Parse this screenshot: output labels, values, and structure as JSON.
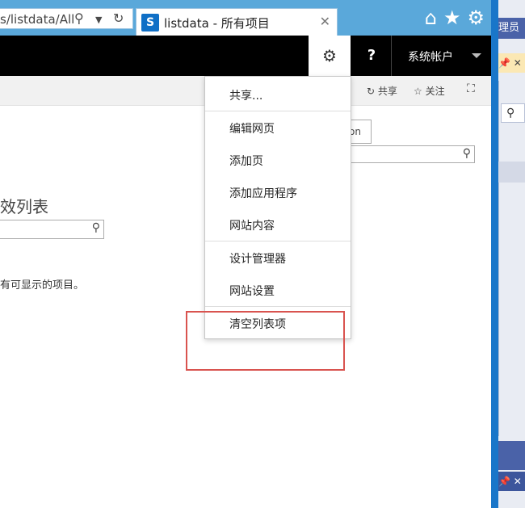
{
  "browser": {
    "address_url": "s/listdata/All",
    "tab_title": "listdata - 所有项目",
    "tab_close": "✕",
    "sp_logo": "S",
    "icons": [
      "home-icon",
      "favorites-star-icon",
      "tools-gear-icon"
    ]
  },
  "suitebar": {
    "help": "?",
    "account": "系统帐户"
  },
  "ribbon": {
    "share": "共享",
    "follow": "关注"
  },
  "page": {
    "button_fragment": "on",
    "list_title_fragment": "效列表",
    "empty_message_fragment": "有可显示的项目。"
  },
  "settings_menu": {
    "items": [
      "共享...",
      "编辑网页",
      "添加页",
      "添加应用程序",
      "网站内容",
      "设计管理器",
      "网站设置",
      "清空列表项"
    ]
  },
  "side_panel": {
    "header": "理员",
    "pin_row": "📌 ✕",
    "bottom_row": "📌 ✕"
  },
  "colors": {
    "ie_chrome": "#5aa8da",
    "suitebar": "#000000",
    "highlight": "#d9534f"
  }
}
